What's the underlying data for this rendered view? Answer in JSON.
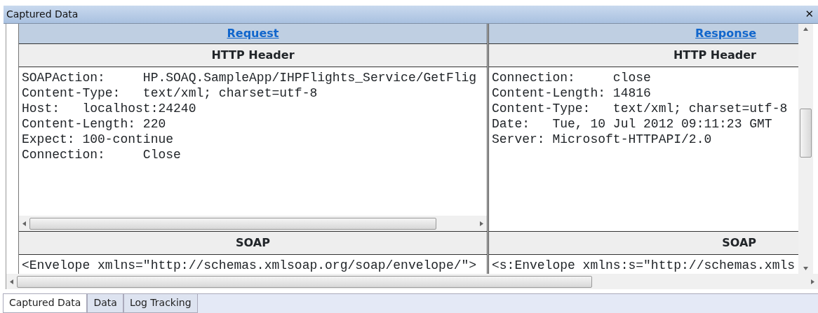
{
  "window": {
    "title": "Captured Data",
    "close": "✕"
  },
  "panes": [
    {
      "title": "Request",
      "sections": [
        {
          "title": "HTTP Header",
          "lines": [
            "SOAPAction:     HP.SOAQ.SampleApp/IHPFlights_Service/GetFlig",
            "Content-Type:   text/xml; charset=utf-8",
            "Host:   localhost:24240",
            "Content-Length: 220",
            "Expect: 100-continue",
            "Connection:     Close"
          ],
          "hscroll": true
        },
        {
          "title": "SOAP",
          "lines": [
            "<Envelope xmlns=\"http://schemas.xmlsoap.org/soap/envelope/\">"
          ]
        }
      ]
    },
    {
      "title": "Response",
      "sections": [
        {
          "title": "HTTP Header",
          "lines": [
            "Connection:     close",
            "Content-Length: 14816",
            "Content-Type:   text/xml; charset=utf-8",
            "Date:   Tue, 10 Jul 2012 09:11:23 GMT",
            "Server: Microsoft-HTTPAPI/2.0"
          ],
          "hscroll": false
        },
        {
          "title": "SOAP",
          "lines": [
            "<s:Envelope xmlns:s=\"http://schemas.xmls"
          ]
        }
      ]
    }
  ],
  "tabs": [
    {
      "label": "Captured Data",
      "selected": true
    },
    {
      "label": "Data",
      "selected": false
    },
    {
      "label": "Log Tracking",
      "selected": false
    }
  ]
}
